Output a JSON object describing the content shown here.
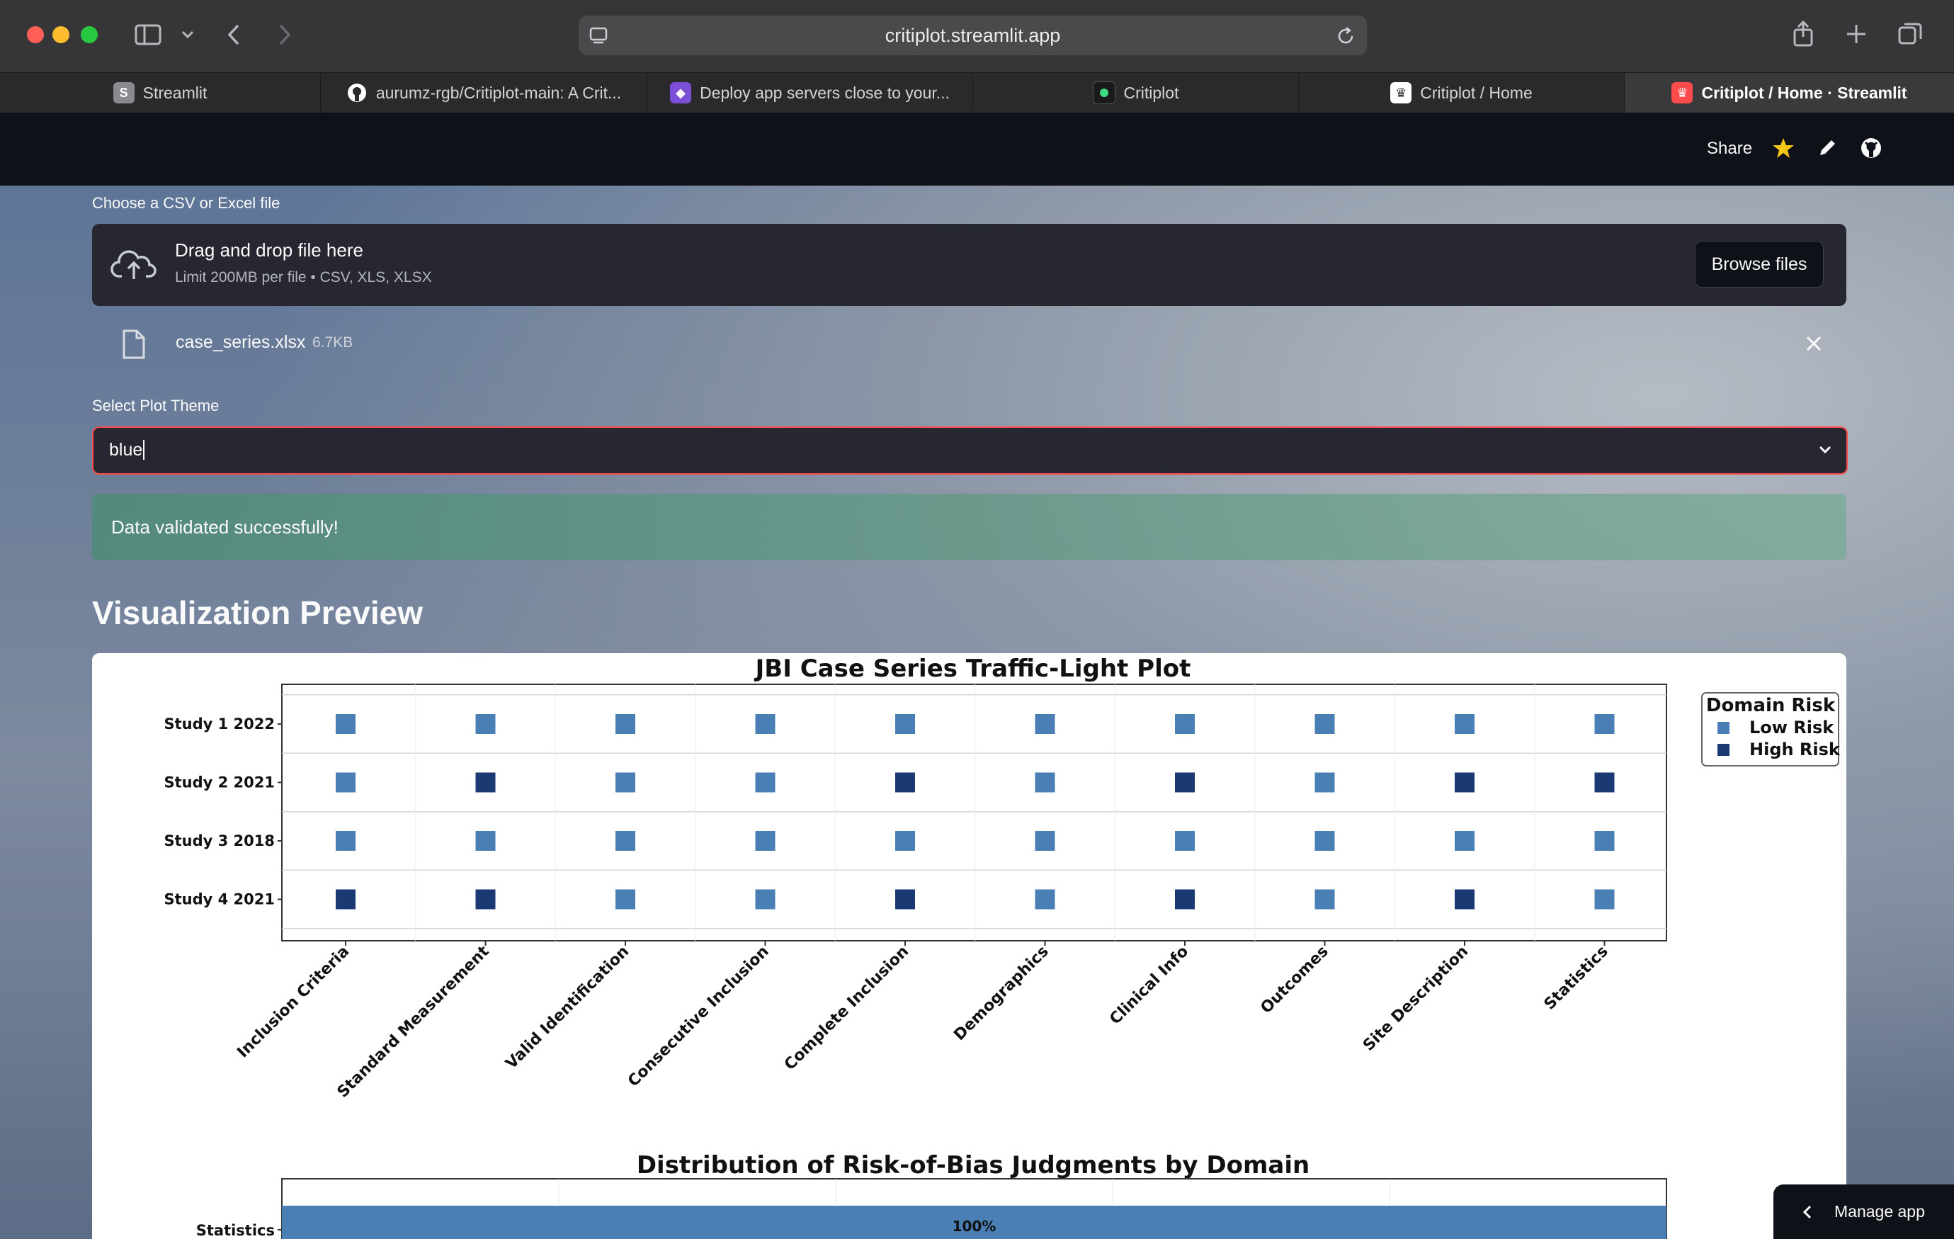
{
  "browser": {
    "url": "critiplot.streamlit.app",
    "tabs": [
      {
        "label": "Streamlit",
        "icon": "streamlit-s-icon",
        "favicon_text": "S"
      },
      {
        "label": "aurumz-rgb/Critiplot-main: A Crit...",
        "icon": "github-icon"
      },
      {
        "label": "Deploy app servers close to your...",
        "icon": "fly-io-icon"
      },
      {
        "label": "Critiplot",
        "icon": "critiplot-dot-icon"
      },
      {
        "label": "Critiplot / Home",
        "icon": "crown-icon"
      },
      {
        "label": "Critiplot / Home · Streamlit",
        "icon": "crown-icon",
        "active": true
      }
    ]
  },
  "header": {
    "share_label": "Share",
    "icons": [
      "star-icon",
      "pencil-icon",
      "github-icon"
    ]
  },
  "uploader": {
    "label": "Choose a CSV or Excel file",
    "drag_text": "Drag and drop file here",
    "limit_text": "Limit 200MB per file • CSV, XLS, XLSX",
    "browse_label": "Browse files",
    "file_name": "case_series.xlsx",
    "file_size": "6.7KB"
  },
  "theme": {
    "label": "Select Plot Theme",
    "value": "blue"
  },
  "status": {
    "message": "Data validated successfully!"
  },
  "preview": {
    "title": "Visualization Preview"
  },
  "colors": {
    "low_risk": "#4a7fb5",
    "high_risk": "#1b3a73",
    "accent": "#ff4b4b"
  },
  "chart_data": [
    {
      "type": "scatter",
      "title": "JBI Case Series Traffic-Light Plot",
      "rows": [
        "Study 1 2022",
        "Study 2 2021",
        "Study 3 2018",
        "Study 4 2021"
      ],
      "columns": [
        "Inclusion Criteria",
        "Standard Measurement",
        "Valid Identification",
        "Consecutive Inclusion",
        "Complete Inclusion",
        "Demographics",
        "Clinical Info",
        "Outcomes",
        "Site Description",
        "Statistics"
      ],
      "values": [
        [
          "Low",
          "Low",
          "Low",
          "Low",
          "Low",
          "Low",
          "Low",
          "Low",
          "Low",
          "Low"
        ],
        [
          "Low",
          "High",
          "Low",
          "Low",
          "High",
          "Low",
          "High",
          "Low",
          "High",
          "High"
        ],
        [
          "Low",
          "Low",
          "Low",
          "Low",
          "Low",
          "Low",
          "Low",
          "Low",
          "Low",
          "Low"
        ],
        [
          "High",
          "High",
          "Low",
          "Low",
          "High",
          "Low",
          "High",
          "Low",
          "High",
          "Low"
        ]
      ],
      "legend_title": "Domain Risk",
      "legend": [
        "Low Risk",
        "High Risk"
      ],
      "legend_position": "top-right",
      "grid": true
    },
    {
      "type": "bar",
      "title": "Distribution of Risk-of-Bias Judgments by Domain",
      "categories": [
        "Statistics"
      ],
      "series": [
        {
          "name": "Low Risk",
          "values": [
            100
          ]
        }
      ],
      "data_labels": [
        "100%"
      ]
    }
  ],
  "footer": {
    "manage_label": "Manage app"
  }
}
